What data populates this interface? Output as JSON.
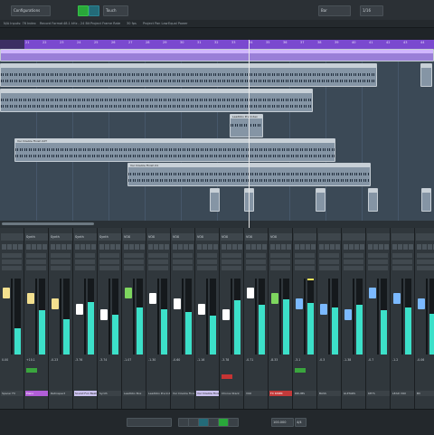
{
  "toolbar": {
    "configuration_label": "Configurations",
    "mode_label": "Touch",
    "device_label": "Bar",
    "snap_label": "1/16",
    "colors": {
      "accent_green": "#29a83a",
      "accent_teal": "#236b79"
    }
  },
  "infoline": {
    "items": [
      "N/A Inputs: 76 Index",
      "Record Format",
      "48.1 kHz - 24 Bit",
      "Project Frame Rate",
      "30 fps",
      "Project Pan Law",
      "Equal Power"
    ]
  },
  "ruler": {
    "ticks": [
      "21",
      "22",
      "23",
      "24",
      "25",
      "26",
      "27",
      "28",
      "29",
      "30",
      "31",
      "32",
      "33",
      "34",
      "35",
      "36",
      "37",
      "38",
      "39",
      "40",
      "41",
      "42",
      "43",
      "44"
    ]
  },
  "clips": [
    {
      "label": "",
      "color": "purple"
    },
    {
      "label": "",
      "color": "gray"
    },
    {
      "label": "",
      "color": "gray"
    },
    {
      "label": "Leadbbo Pre Index",
      "color": "gray"
    },
    {
      "label": "Voc Double Finish 02T",
      "color": "gray"
    },
    {
      "label": "Voc Double Finish 01",
      "color": "gray"
    }
  ],
  "mixer": {
    "strips": [
      {
        "name": "Spacer FX",
        "header": "",
        "value": "0.00",
        "meter": 0.35,
        "name_color": ""
      },
      {
        "name": "Piano",
        "header": "Synth",
        "value": "+10.1",
        "meter": 0.58,
        "name_color": "purple"
      },
      {
        "name": "Retrospect",
        "header": "Synth",
        "value": "-0.23",
        "meter": 0.46,
        "name_color": ""
      },
      {
        "name": "Sound Fun Beats",
        "header": "Synth",
        "value": "-3.76",
        "meter": 0.69,
        "name_color": "lavender"
      },
      {
        "name": "Synth",
        "header": "Synth",
        "value": "-3.74",
        "meter": 0.52,
        "name_color": ""
      },
      {
        "name": "Leadbbo Box",
        "header": "VOX",
        "value": "-1.07",
        "meter": 0.62,
        "name_color": ""
      },
      {
        "name": "Leadbbo Pre Index",
        "header": "VOX",
        "value": "-1.30",
        "meter": 0.6,
        "name_color": ""
      },
      {
        "name": "Voc Double Finish",
        "header": "VOX",
        "value": "-0.60",
        "meter": 0.56,
        "name_color": ""
      },
      {
        "name": "Voc Double Finish",
        "header": "VOX",
        "value": "-1.16",
        "meter": 0.51,
        "name_color": "lavender"
      },
      {
        "name": "Chorus Stack",
        "header": "VOX",
        "value": "-3.78",
        "meter": 0.71,
        "name_color": ""
      },
      {
        "name": "VOX",
        "header": "VOX",
        "value": "-0.71",
        "meter": 0.66,
        "name_color": ""
      },
      {
        "name": "FX RISER",
        "header": "VOX",
        "value": "-8.33",
        "meter": 0.73,
        "name_color": "red"
      },
      {
        "name": "DRUMS",
        "header": "",
        "value": "-3.1",
        "meter": 0.68,
        "name_color": ""
      },
      {
        "name": "BASS",
        "header": "",
        "value": "-0.3",
        "meter": 0.62,
        "name_color": ""
      },
      {
        "name": "GUITARS",
        "header": "",
        "value": "-1.38",
        "meter": 0.66,
        "name_color": ""
      },
      {
        "name": "KEYS",
        "header": "",
        "value": "-0.7",
        "meter": 0.58,
        "name_color": ""
      },
      {
        "name": "LEAD VOX",
        "header": "",
        "value": "-1.2",
        "meter": 0.62,
        "name_color": ""
      },
      {
        "name": "BV",
        "header": "",
        "value": "-0.06",
        "meter": 0.54,
        "name_color": ""
      }
    ]
  },
  "transport": {
    "position": "100.000",
    "tempo": "4/4",
    "sig": "4/4"
  },
  "colors": {
    "project_bg": "#3b4956",
    "ruler_purple": "#7a49cf",
    "meter_teal": "#3ce0c9",
    "playhead": "#e6e6e6"
  }
}
